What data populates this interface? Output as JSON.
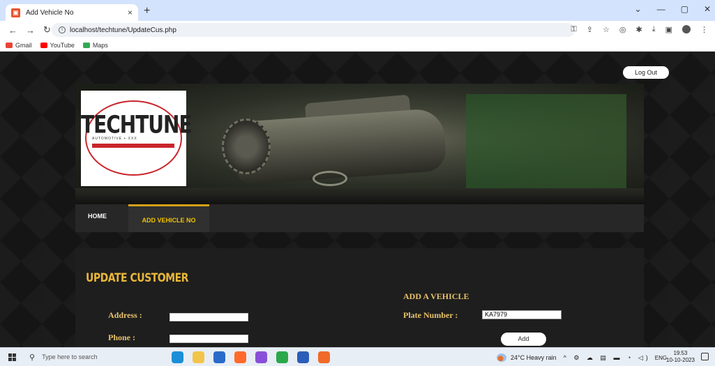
{
  "browser": {
    "tab_title": "Add Vehicle No",
    "tab_favicon": "techtune-favicon",
    "tab_close": "×",
    "new_tab": "+",
    "url": "localhost/techtune/UpdateCus.php",
    "bookmarks": [
      {
        "label": "Gmail",
        "color": "#ea4335"
      },
      {
        "label": "YouTube",
        "color": "#ff0000"
      },
      {
        "label": "Maps",
        "color": "#34a853"
      }
    ]
  },
  "header": {
    "logout_label": "Log Out",
    "logo_text": "TECHTUNE",
    "logo_sub": "AUTOMOTIVE + XXX"
  },
  "nav": {
    "items": [
      {
        "label": "HOME",
        "active": false
      },
      {
        "label": "ADD VEHICLE NO",
        "active": true
      }
    ]
  },
  "form": {
    "title": "UPDATE CUSTOMER",
    "address_label": "Address :",
    "address_value": "",
    "phone_label": "Phone :",
    "phone_value": ""
  },
  "vehicle": {
    "title": "ADD A VEHICLE",
    "plate_label": "Plate Number :",
    "plate_value": "KA7979",
    "add_label": "Add"
  },
  "taskbar": {
    "search_placeholder": "Type here to search",
    "weather": "24°C  Heavy rain",
    "lang": "ENG",
    "time": "19:53",
    "date": "10-10-2023",
    "apps": [
      {
        "name": "edge-icon",
        "color": "#1a8fd8"
      },
      {
        "name": "file-explorer-icon",
        "color": "#f2c54a"
      },
      {
        "name": "mail-icon",
        "color": "#2a6bc9"
      },
      {
        "name": "firefox-icon",
        "color": "#ff6a2a"
      },
      {
        "name": "copilot-icon",
        "color": "#8a4fd8"
      },
      {
        "name": "chrome-icon",
        "color": "#2aa84a"
      },
      {
        "name": "word-icon",
        "color": "#2b5eb8"
      },
      {
        "name": "xampp-icon",
        "color": "#f06a2a"
      }
    ]
  },
  "colors": {
    "accent_gold": "#e8b63a",
    "nav_active": "#f2c200",
    "logo_red": "#c8262b"
  }
}
